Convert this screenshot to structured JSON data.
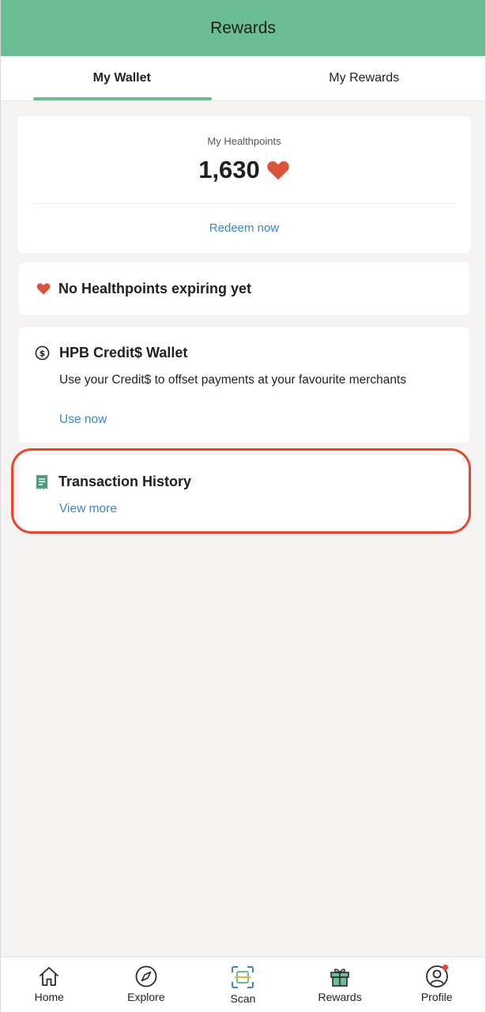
{
  "header": {
    "title": "Rewards"
  },
  "tabs": [
    {
      "label": "My Wallet",
      "active": true
    },
    {
      "label": "My Rewards",
      "active": false
    }
  ],
  "healthpoints": {
    "label": "My Healthpoints",
    "value": "1,630",
    "redeem_label": "Redeem now"
  },
  "expiry": {
    "text": "No Healthpoints expiring yet"
  },
  "wallet": {
    "title": "HPB Credit$ Wallet",
    "description": "Use your Credit$ to offset payments at your favourite merchants",
    "link_label": "Use now"
  },
  "transactions": {
    "title": "Transaction History",
    "link_label": "View more"
  },
  "bottom_nav": [
    {
      "label": "Home",
      "icon": "home-icon"
    },
    {
      "label": "Explore",
      "icon": "compass-icon"
    },
    {
      "label": "Scan",
      "icon": "scan-icon"
    },
    {
      "label": "Rewards",
      "icon": "gift-icon"
    },
    {
      "label": "Profile",
      "icon": "profile-icon"
    }
  ],
  "colors": {
    "header_green": "#6bbd94",
    "heart_orange": "#d9553a",
    "link_blue": "#3b86c6",
    "highlight_red": "#e5472e"
  }
}
